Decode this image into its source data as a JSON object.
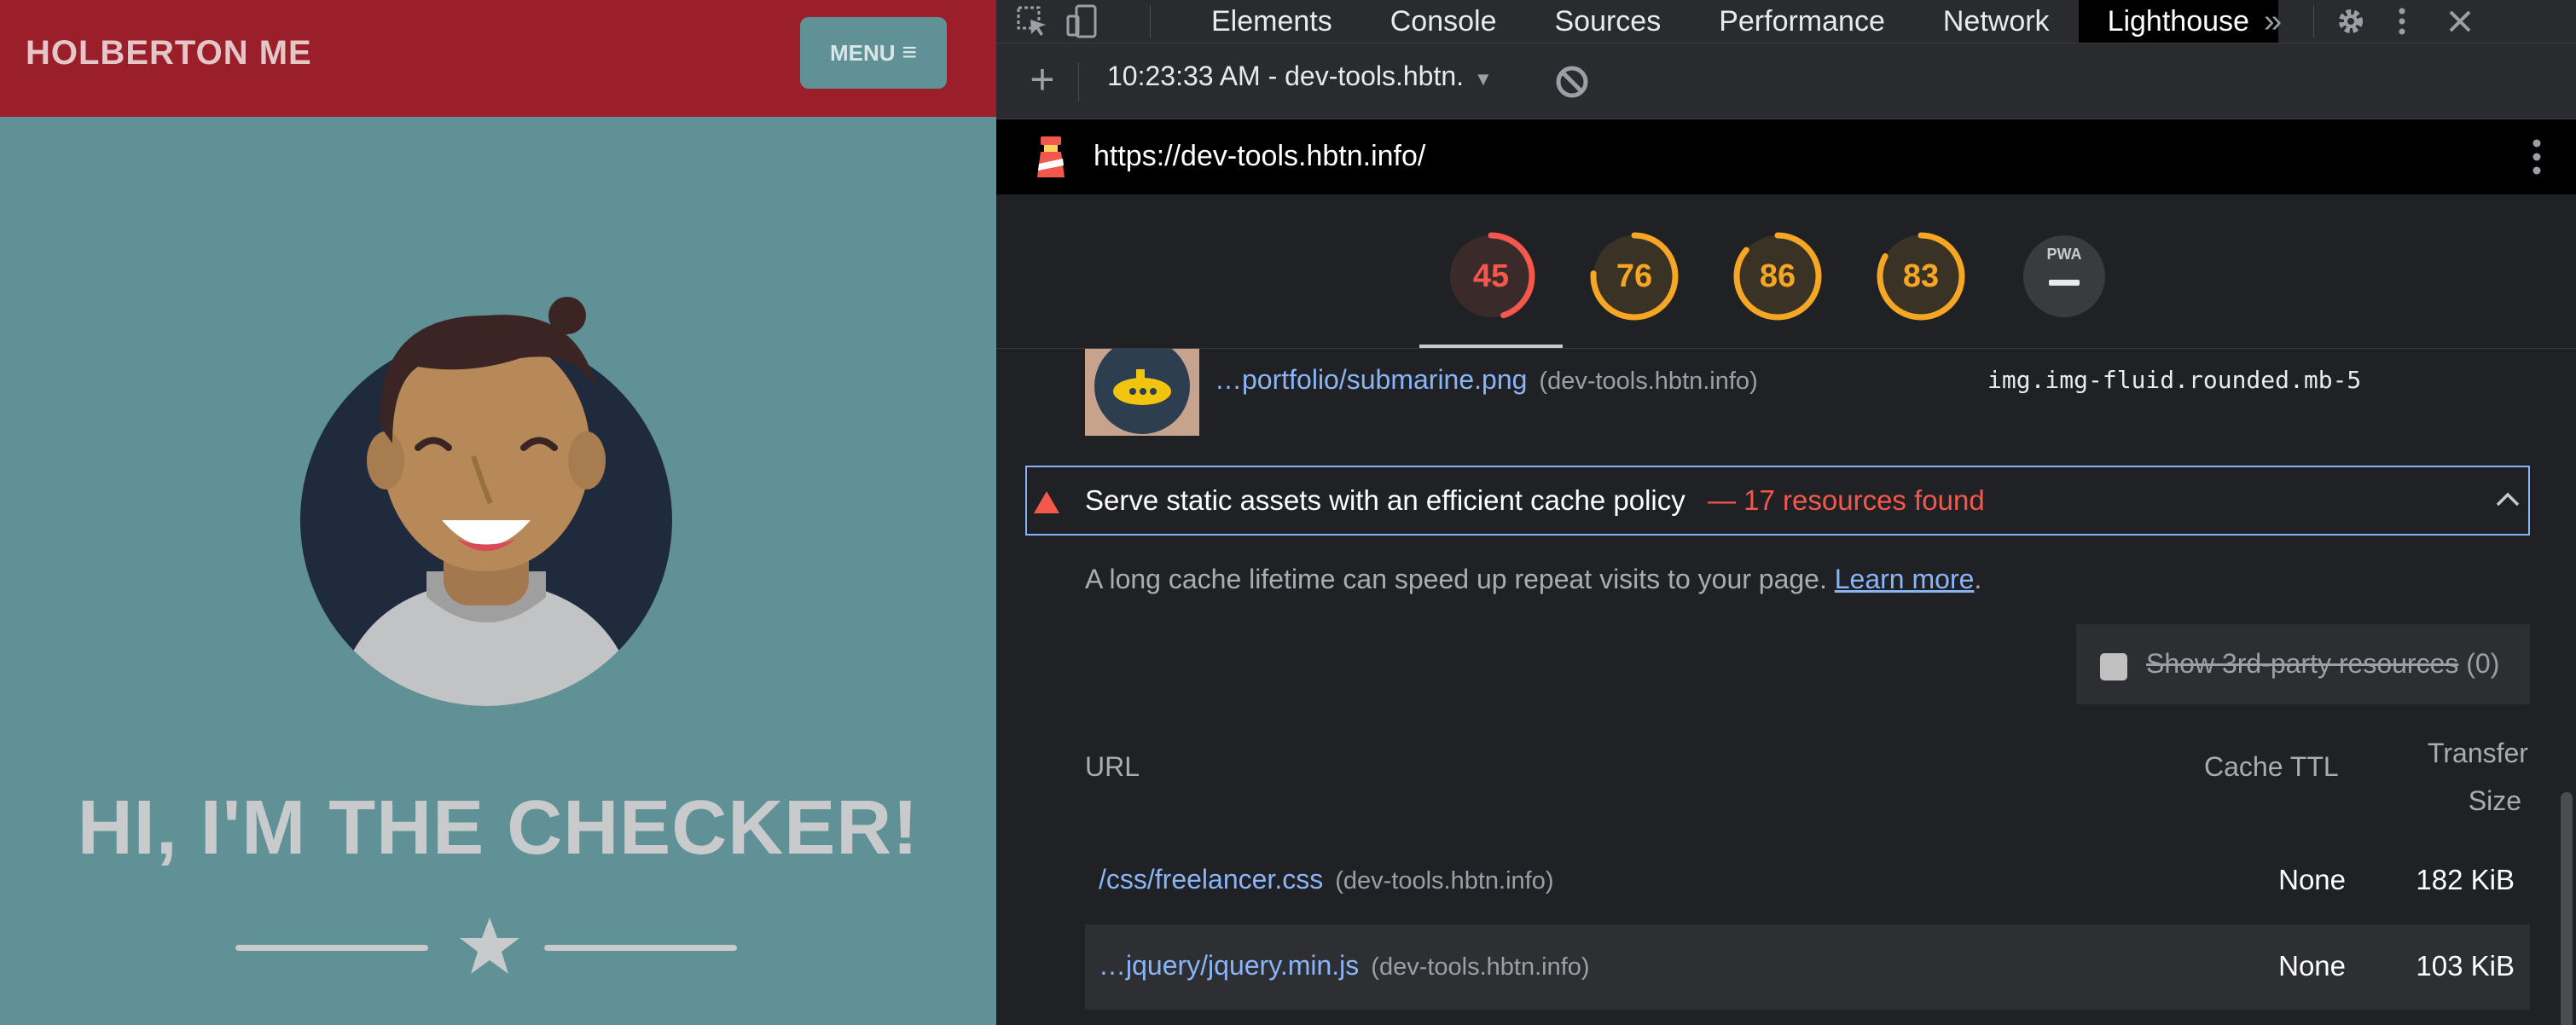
{
  "site": {
    "brand": "HOLBERTON ME",
    "menu_label": "MENU",
    "menu_icon": "hamburger-icon",
    "headline": "HI, I'M THE CHECKER!",
    "divider_icon": "star-icon",
    "colors": {
      "nav": "#9b1f2a",
      "background": "#5f9197",
      "headline": "#c9cacb"
    }
  },
  "devtools": {
    "toolbar_icons": [
      "inspect-element-icon",
      "device-toggle-icon"
    ],
    "tabs": [
      "Elements",
      "Console",
      "Sources",
      "Performance",
      "Network",
      "Lighthouse"
    ],
    "active_tab": "Lighthouse",
    "more_tabs_icon": "chevron-double-right-icon",
    "right_icons": [
      "gear-icon",
      "kebab-menu-icon",
      "close-icon"
    ],
    "report_select": "10:23:33 AM - dev-tools.hbtn.",
    "url": "https://dev-tools.hbtn.info/",
    "scores": [
      {
        "value": "45",
        "level": "fail",
        "fraction": 0.45,
        "color": "#f4574b"
      },
      {
        "value": "76",
        "level": "average",
        "fraction": 0.76,
        "color": "#f5a623"
      },
      {
        "value": "86",
        "level": "average",
        "fraction": 0.86,
        "color": "#f5a623"
      },
      {
        "value": "83",
        "level": "average",
        "fraction": 0.83,
        "color": "#f5a623"
      },
      {
        "value": "PWA",
        "level": "na",
        "color": "#9aa0a6"
      }
    ],
    "prev_row": {
      "link": "…portfolio/submarine.png",
      "host": "(dev-tools.hbtn.info)",
      "selector": "img.img-fluid.rounded.mb-5"
    },
    "audit": {
      "title": "Serve static assets with an efficient cache policy",
      "found": "— 17 resources found",
      "description": "A long cache lifetime can speed up repeat visits to your page.",
      "learn_more": "Learn more",
      "third_party_label": "Show 3rd-party resources",
      "third_party_count": "(0)",
      "columns": {
        "url": "URL",
        "ttl": "Cache TTL",
        "size_line1": "Transfer",
        "size_line2": "Size"
      },
      "rows": [
        {
          "url": "/css/freelancer.css",
          "host": "(dev-tools.hbtn.info)",
          "ttl": "None",
          "size": "182 KiB"
        },
        {
          "url": "…jquery/jquery.min.js",
          "host": "(dev-tools.hbtn.info)",
          "ttl": "None",
          "size": "103 KiB"
        }
      ]
    }
  }
}
